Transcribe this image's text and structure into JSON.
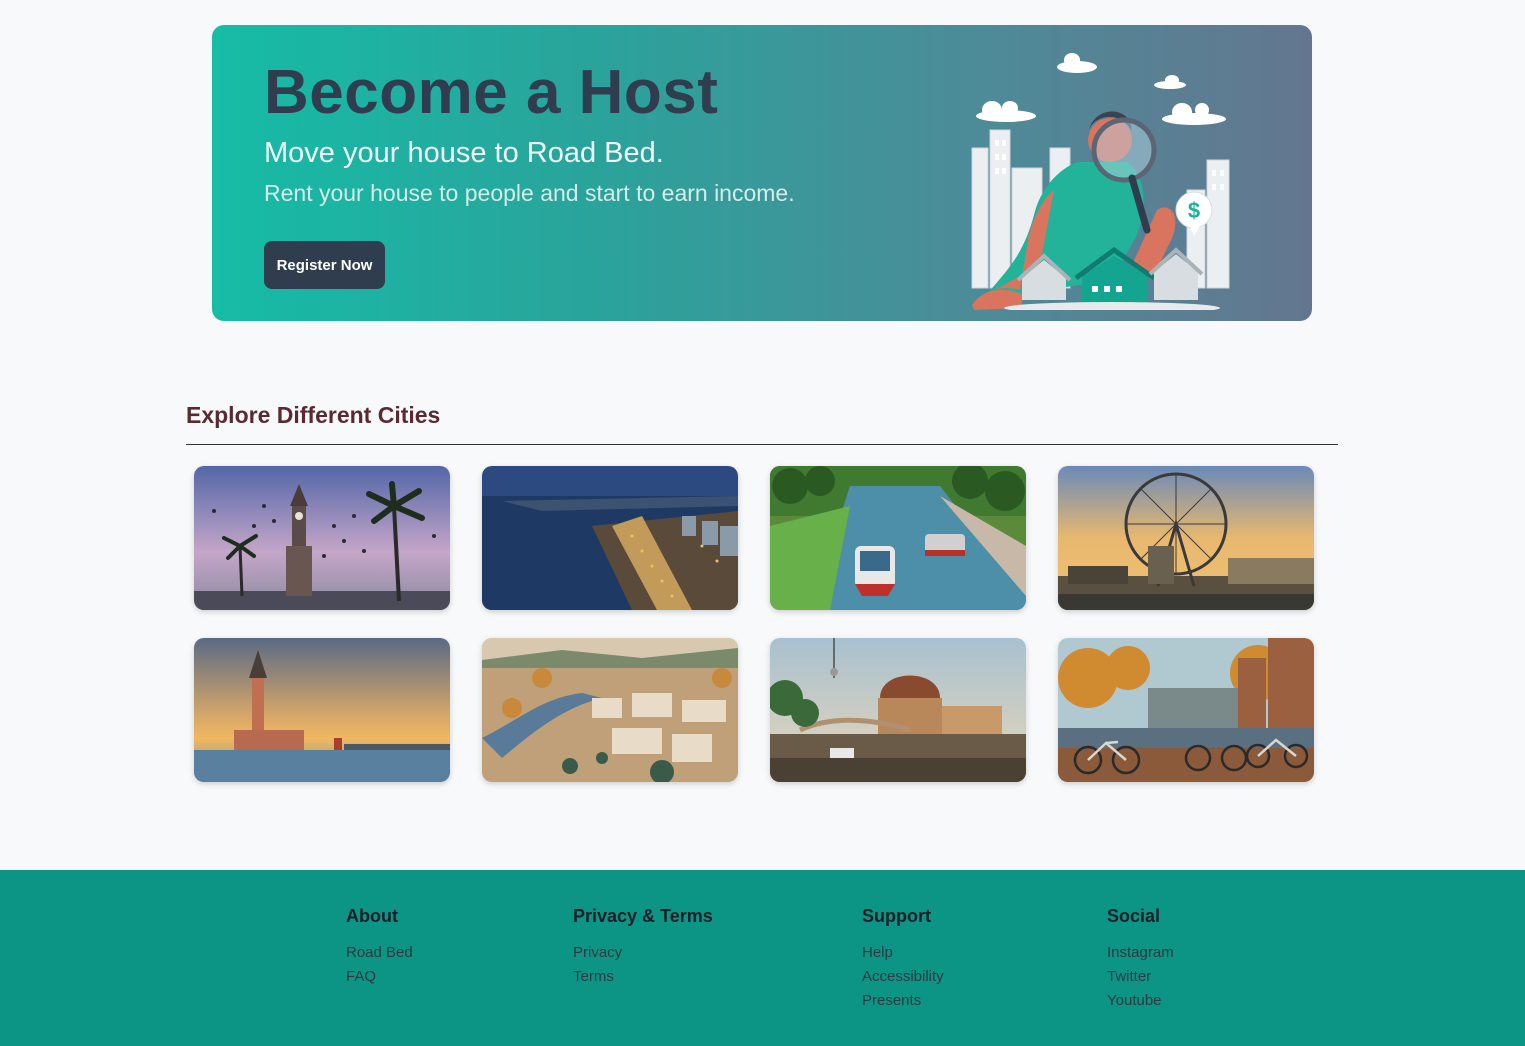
{
  "hero": {
    "title": "Become a Host",
    "subtitle": "Move your house to Road Bed.",
    "description": "Rent your house to people and start to earn income.",
    "register_button": "Register Now",
    "illustration_symbol": "$"
  },
  "explore": {
    "title": "Explore Different Cities",
    "cities": [
      {
        "image": "clock-tower-palms-sunset"
      },
      {
        "image": "coastal-city-night"
      },
      {
        "image": "canal-boats-park"
      },
      {
        "image": "ferris-wheel-river-sunset"
      },
      {
        "image": "maiden-tower-sea-sunset"
      },
      {
        "image": "river-city-panorama"
      },
      {
        "image": "museum-dome-river-boat"
      },
      {
        "image": "canal-bicycles-autumn"
      }
    ]
  },
  "footer": {
    "columns": [
      {
        "heading": "About",
        "links": [
          "Road Bed",
          "FAQ"
        ]
      },
      {
        "heading": "Privacy & Terms",
        "links": [
          "Privacy",
          "Terms"
        ]
      },
      {
        "heading": "Support",
        "links": [
          "Help",
          "Accessibility",
          "Presents"
        ]
      },
      {
        "heading": "Social",
        "links": [
          "Instagram",
          "Twitter",
          "Youtube"
        ]
      }
    ]
  },
  "colors": {
    "hero_gradient_start": "#16bca6",
    "hero_gradient_end": "#64768f",
    "dark": "#2f3d4e",
    "section_title": "#5a2a33",
    "footer_bg": "#0c9484"
  }
}
